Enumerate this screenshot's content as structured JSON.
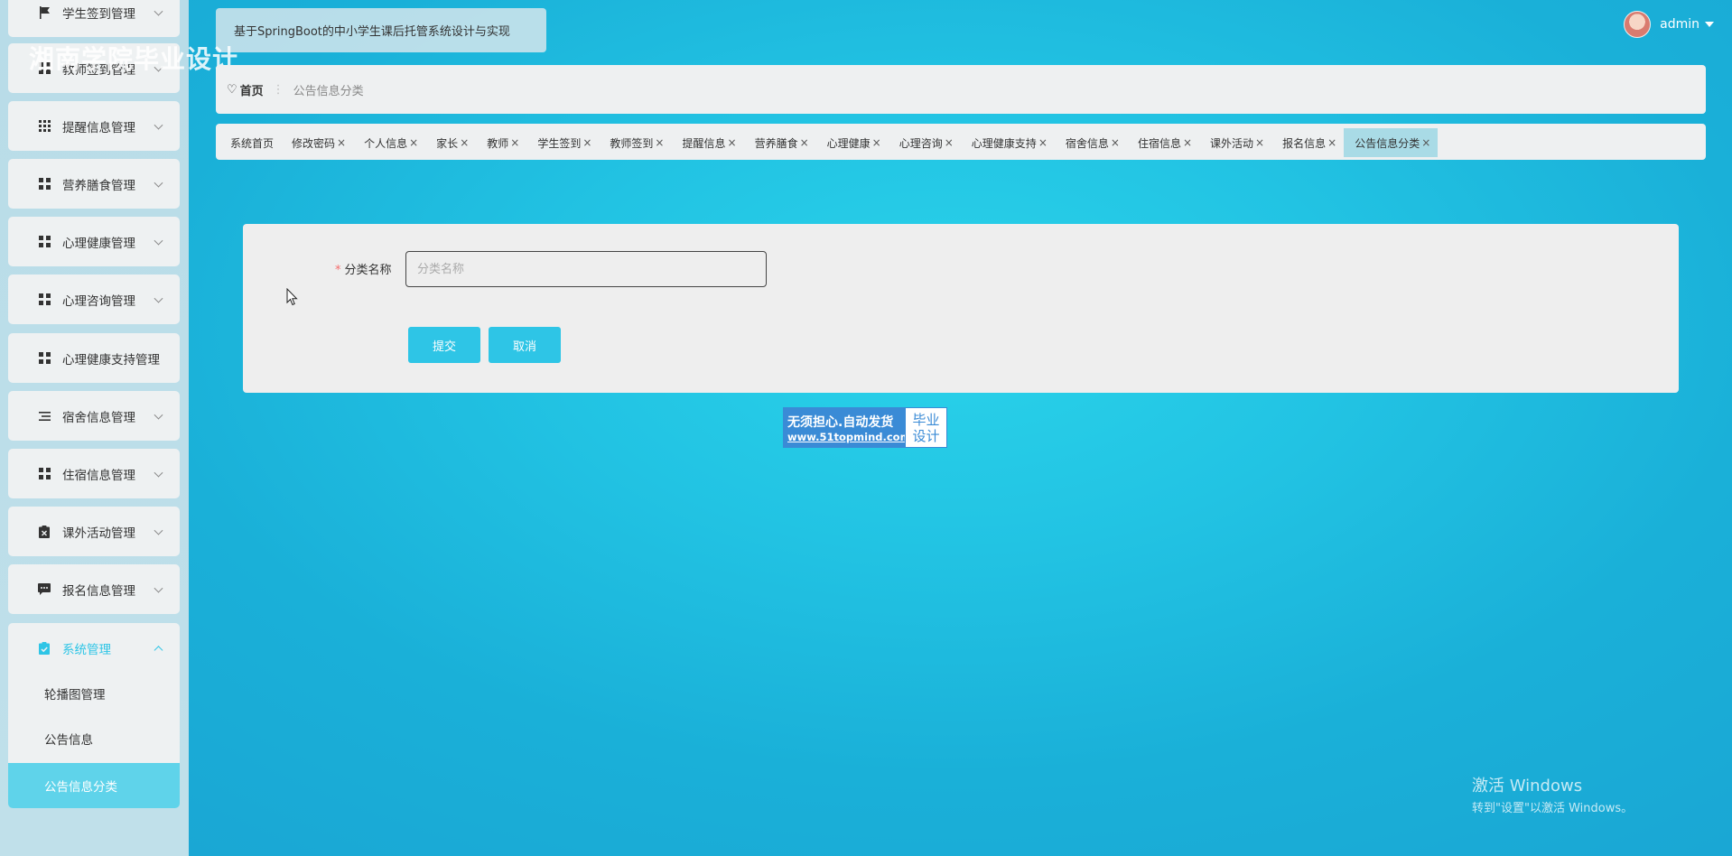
{
  "sidebar": {
    "items": [
      {
        "label": "学生签到管理",
        "icon": "flag-icon"
      },
      {
        "label": "教师签到管理",
        "icon": "grid-icon"
      },
      {
        "label": "提醒信息管理",
        "icon": "grid9-icon"
      },
      {
        "label": "营养膳食管理",
        "icon": "grid-icon"
      },
      {
        "label": "心理健康管理",
        "icon": "grid-icon"
      },
      {
        "label": "心理咨询管理",
        "icon": "grid-icon"
      },
      {
        "label": "心理健康支持管理",
        "icon": "grid-icon"
      },
      {
        "label": "宿舍信息管理",
        "icon": "list-icon"
      },
      {
        "label": "住宿信息管理",
        "icon": "grid-icon"
      },
      {
        "label": "课外活动管理",
        "icon": "clipboard-x-icon"
      },
      {
        "label": "报名信息管理",
        "icon": "comment-icon"
      },
      {
        "label": "系统管理",
        "icon": "clipboard-check-icon"
      }
    ],
    "sub_items": [
      {
        "label": "轮播图管理"
      },
      {
        "label": "公告信息"
      },
      {
        "label": "公告信息分类"
      }
    ]
  },
  "header": {
    "title": "基于SpringBoot的中小学生课后托管系统设计与实现",
    "watermark": "湘南学院毕业设计",
    "user": "admin"
  },
  "breadcrumb": {
    "home": "首页",
    "current": "公告信息分类"
  },
  "tags": [
    {
      "label": "系统首页",
      "closable": false
    },
    {
      "label": "修改密码",
      "closable": true
    },
    {
      "label": "个人信息",
      "closable": true
    },
    {
      "label": "家长",
      "closable": true
    },
    {
      "label": "教师",
      "closable": true
    },
    {
      "label": "学生签到",
      "closable": true
    },
    {
      "label": "教师签到",
      "closable": true
    },
    {
      "label": "提醒信息",
      "closable": true
    },
    {
      "label": "营养膳食",
      "closable": true
    },
    {
      "label": "心理健康",
      "closable": true
    },
    {
      "label": "心理咨询",
      "closable": true
    },
    {
      "label": "心理健康支持",
      "closable": true
    },
    {
      "label": "宿舍信息",
      "closable": true
    },
    {
      "label": "住宿信息",
      "closable": true
    },
    {
      "label": "课外活动",
      "closable": true
    },
    {
      "label": "报名信息",
      "closable": true
    },
    {
      "label": "公告信息分类",
      "closable": true,
      "active": true
    }
  ],
  "form": {
    "field_label": "分类名称",
    "field_placeholder": "分类名称",
    "field_value": "",
    "submit_label": "提交",
    "cancel_label": "取消"
  },
  "ad": {
    "line1": "无须担心.自动发货",
    "line2": "www.51topmind.com",
    "right1": "毕业",
    "right2": "设计"
  },
  "os_notice": {
    "line1": "激活 Windows",
    "line2": "转到\"设置\"以激活 Windows。"
  },
  "colors": {
    "accent": "#2ec5e6",
    "active_tag": "#a9dbe6",
    "required": "#f56c6c"
  }
}
